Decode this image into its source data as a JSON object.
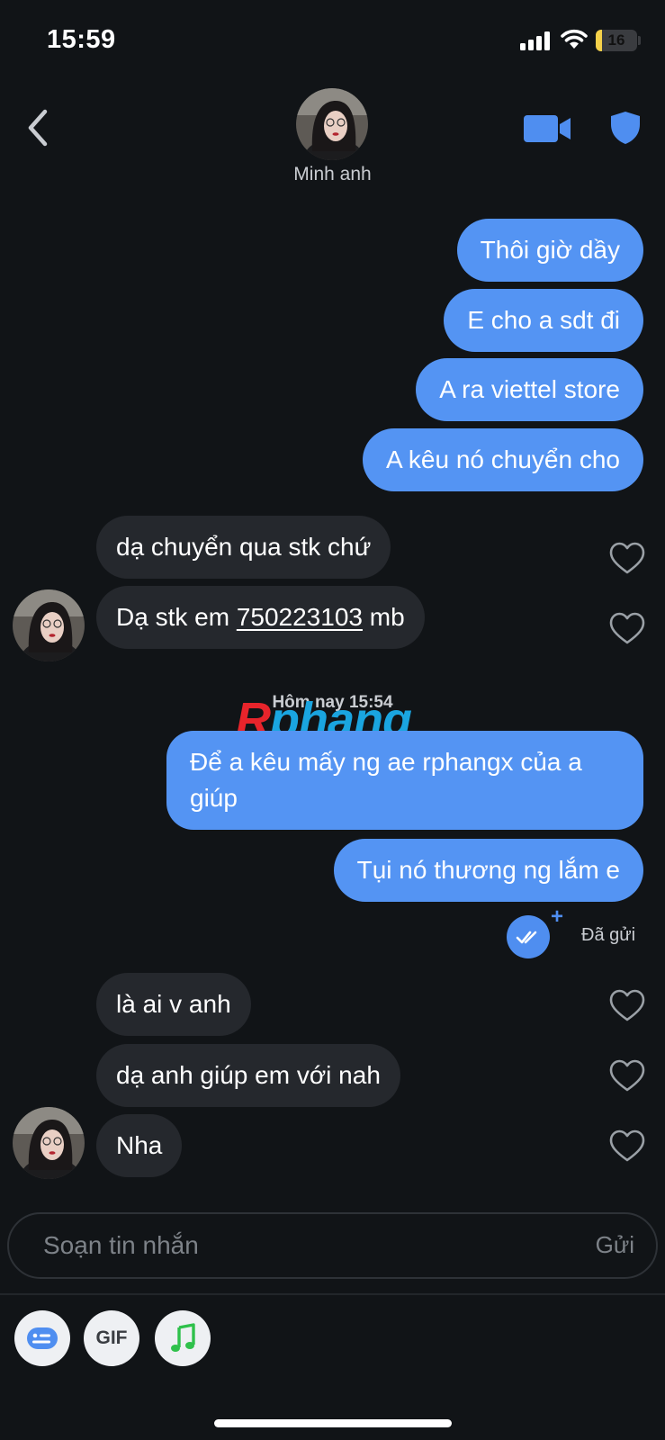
{
  "status_bar": {
    "time": "15:59",
    "battery_level": "16"
  },
  "header": {
    "contact_name": "Minh anh"
  },
  "messages": {
    "m1": "Thôi giờ dầy",
    "m2": "E cho a sdt đi",
    "m3": "A ra viettel store",
    "m4": "A kêu nó chuyển cho",
    "m5": "dạ chuyển qua stk chứ",
    "m6_prefix": "Dạ stk em ",
    "m6_account": "750223103",
    "m6_suffix": " mb",
    "timestamp": "Hôm nay 15:54",
    "m7": "Để a kêu mấy ng ae rphangx của a giúp",
    "m8": "Tụi nó thương ng lắm e",
    "sent_status": "Đã gửi",
    "m9": "là ai v anh",
    "m10": "dạ anh giúp em với nah",
    "m11": "Nha"
  },
  "watermark": {
    "first": "R",
    "rest": "phang"
  },
  "composer": {
    "placeholder": "Soạn tin nhắn",
    "send_label": "Gửi"
  },
  "toolbar": {
    "gif_label": "GIF"
  },
  "colors": {
    "outgoing_bubble": "#5494f3",
    "incoming_bubble": "#25282d",
    "background": "#111417",
    "accent": "#4f8ef0"
  },
  "icons": [
    "back-icon",
    "video-call-icon",
    "shield-icon",
    "heart-icon",
    "double-check-icon",
    "sticker-icon",
    "music-note-icon"
  ]
}
